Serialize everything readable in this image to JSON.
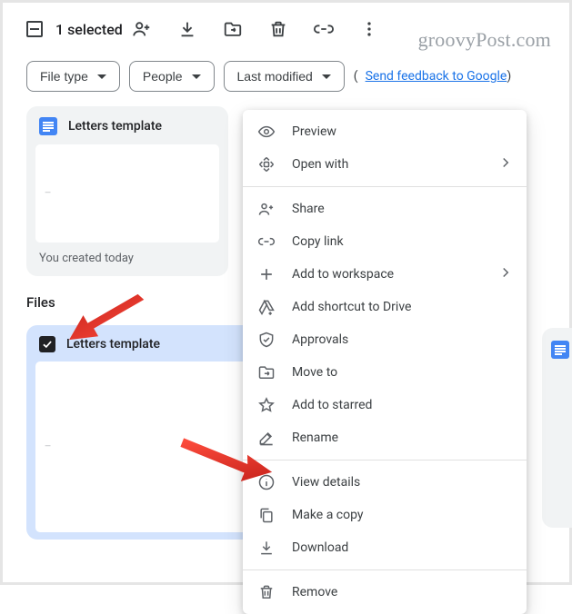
{
  "watermark": "groovyPost.com",
  "toolbar": {
    "selection_text": "1 selected"
  },
  "chips": {
    "file_type": "File type",
    "people": "People",
    "last_modified": "Last modified"
  },
  "feedback": {
    "open": "(",
    "text": "Send feedback to Google",
    "close": ")"
  },
  "card1": {
    "title": "Letters template",
    "preview_stub": "—",
    "footer": "You created today"
  },
  "section": {
    "files": "Files"
  },
  "card2": {
    "title": "Letters template",
    "preview_stub": "—"
  },
  "menu": {
    "preview": "Preview",
    "open_with": "Open with",
    "share": "Share",
    "copy_link": "Copy link",
    "add_workspace": "Add to workspace",
    "add_shortcut": "Add shortcut to Drive",
    "approvals": "Approvals",
    "move_to": "Move to",
    "add_starred": "Add to starred",
    "rename": "Rename",
    "view_details": "View details",
    "make_copy": "Make a copy",
    "download": "Download",
    "remove": "Remove"
  }
}
